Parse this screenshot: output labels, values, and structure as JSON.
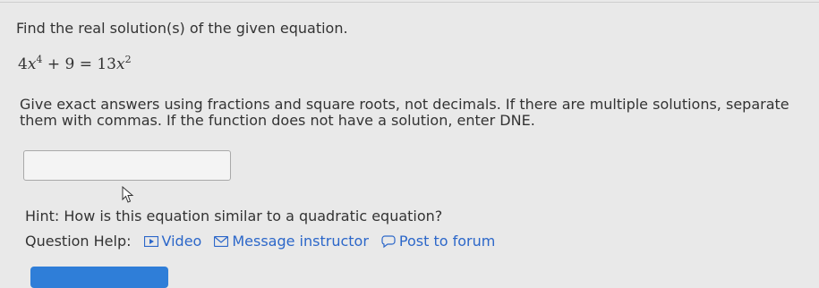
{
  "question": {
    "prompt": "Find the real solution(s) of the given equation.",
    "equation": {
      "coef1": "4",
      "var": "x",
      "exp1": "4",
      "mid": "+ 9 = 13",
      "exp2": "2"
    },
    "instructions": "Give exact answers using fractions and square roots, not decimals. If there are multiple solutions, separate them with commas. If the function does not have a solution, enter DNE.",
    "answer_value": "",
    "hint": "Hint: How is this equation similar to a quadratic equation?"
  },
  "help": {
    "label": "Question Help:",
    "links": [
      {
        "label": "Video",
        "icon": "video-icon"
      },
      {
        "label": "Message instructor",
        "icon": "envelope-icon"
      },
      {
        "label": "Post to forum",
        "icon": "speech-bubble-icon"
      }
    ]
  },
  "colors": {
    "link": "#2c67c9",
    "submit": "#2f7ed8"
  }
}
